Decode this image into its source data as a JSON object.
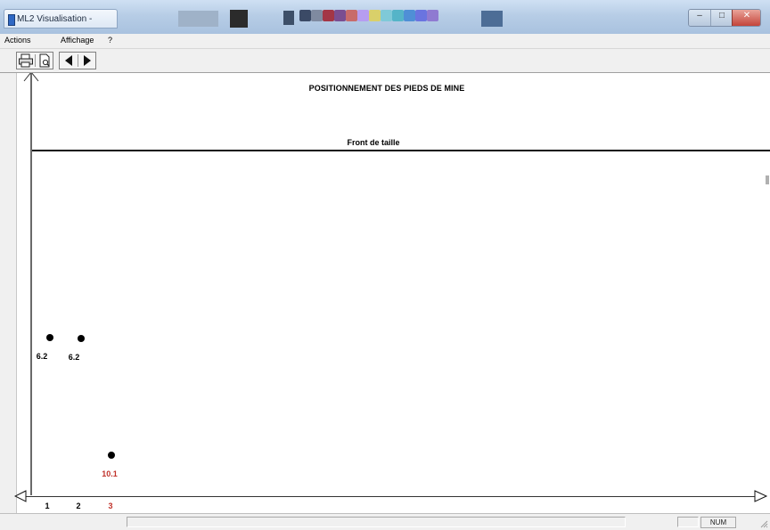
{
  "window": {
    "title": "ML2 Visualisation -",
    "controls": [
      "minimize-icon",
      "maximize-icon",
      "close-icon"
    ]
  },
  "menu": {
    "items": [
      {
        "label": "Actions"
      },
      {
        "label": "Affichage"
      },
      {
        "label": "?"
      }
    ]
  },
  "toolbar": {
    "buttons": [
      "printer-icon",
      "print-preview-icon",
      "previous-icon",
      "next-icon"
    ]
  },
  "view": {
    "title": "POSITIONNEMENT DES PIEDS DE MINE",
    "front_label": "Front de taille"
  },
  "holes": [
    {
      "column": 1,
      "value": "6.2",
      "color": "#000000"
    },
    {
      "column": 2,
      "value": "6.2",
      "color": "#000000"
    },
    {
      "column": 3,
      "value": "10.1",
      "color": "#c0322a"
    }
  ],
  "axis": {
    "ticks": [
      {
        "label": "1",
        "color": "#000000"
      },
      {
        "label": "2",
        "color": "#000000"
      },
      {
        "label": "3",
        "color": "#c0322a"
      }
    ]
  },
  "status": {
    "num_indicator": "NUM"
  }
}
